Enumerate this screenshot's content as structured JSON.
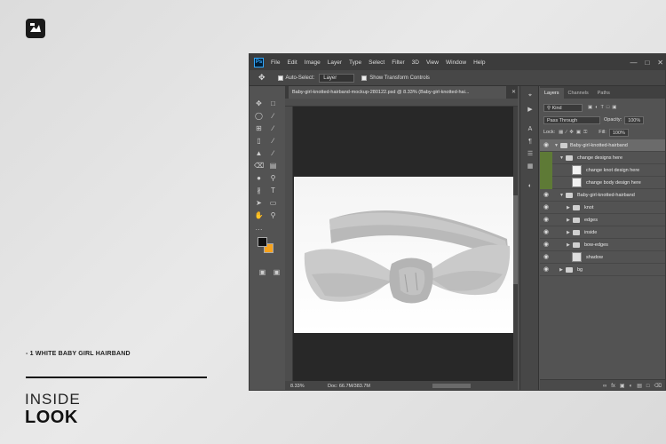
{
  "left_panel": {
    "note": "- 1 WHITE BABY GIRL HAIRBAND",
    "title_line1": "INSIDE",
    "title_line2": "LOOK"
  },
  "photoshop": {
    "logo": "Ps",
    "menu": [
      "File",
      "Edit",
      "Image",
      "Layer",
      "Type",
      "Select",
      "Filter",
      "3D",
      "View",
      "Window",
      "Help"
    ],
    "options": {
      "auto_select_label": "Auto-Select:",
      "auto_select_value": "Layer",
      "transform_label": "Show Transform Controls"
    },
    "document_tab": "Baby-girl-knotted-hairband-mockup-280122.psd @ 8.33% (Baby-girl-knotted-hai...",
    "status": {
      "zoom": "8.33%",
      "doc": "Doc: 66.7M/383.7M"
    },
    "panel_tabs": [
      "Layers",
      "Channels",
      "Paths"
    ],
    "filter_kind": "Kind",
    "blend_mode": "Pass Through",
    "opacity_label": "Opacity:",
    "opacity_value": "100%",
    "lock_label": "Lock:",
    "fill_label": "Fill:",
    "fill_value": "100%",
    "layers": [
      {
        "name": "Baby-girl-knotted-hairband",
        "kind": "group"
      },
      {
        "name": "change designs here",
        "kind": "group"
      },
      {
        "name": "change knot design here",
        "kind": "smart-object"
      },
      {
        "name": "change body design here",
        "kind": "smart-object"
      },
      {
        "name": "Baby-girl-knotted-hairband",
        "kind": "group"
      },
      {
        "name": "knot",
        "kind": "group"
      },
      {
        "name": "edges",
        "kind": "group"
      },
      {
        "name": "inside",
        "kind": "group"
      },
      {
        "name": "bow-edges",
        "kind": "group"
      },
      {
        "name": "shadow",
        "kind": "layer"
      },
      {
        "name": "bg",
        "kind": "group"
      }
    ]
  },
  "colors": {
    "foreground": "#111111",
    "background": "#f7a21b",
    "ps_accent": "#31a8ff",
    "label_green": "#5e7a36"
  }
}
